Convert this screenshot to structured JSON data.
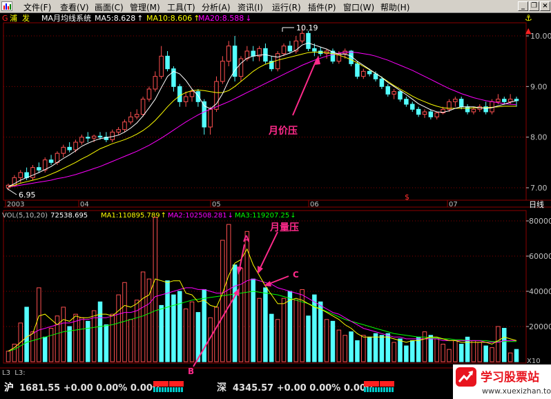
{
  "menu": {
    "items": [
      "文件(F)",
      "查看(V)",
      "画面(C)",
      "管理(M)",
      "工具(T)",
      "分析(A)",
      "资讯(I)",
      "运行(R)",
      "插件(P)",
      "窗口(W)",
      "帮助(H)"
    ]
  },
  "price_panel": {
    "stock_marker": "G",
    "stock_name": "浦  发",
    "indicator_label": "MA月均线系统",
    "ma_labels": [
      {
        "text": "MA5:8.628",
        "arrow": "↑",
        "color": "#ffffff"
      },
      {
        "text": "MA10:8.606",
        "arrow": "↑",
        "color": "#ffff00"
      },
      {
        "text": "MA20:8.588",
        "arrow": "↓",
        "color": "#ff00ff"
      }
    ],
    "y_ticks": [
      "10.00",
      "9.00",
      "8.00",
      "7.00"
    ],
    "high_label": "10.19",
    "low_label": "6.95",
    "annotation": "月价压"
  },
  "x_axis": {
    "labels": [
      "2003",
      "04",
      "05",
      "06",
      "07"
    ],
    "marker": "$",
    "right_label": "日线"
  },
  "volume_panel": {
    "title": "VOL(5,10,20)",
    "vol_value": "72538.695",
    "ma_labels": [
      {
        "text": "MA1:110895.789",
        "arrow": "↑",
        "color": "#ffff00"
      },
      {
        "text": "MA2:102508.281",
        "arrow": "↓",
        "color": "#ff00ff"
      },
      {
        "text": "MA3:119207.25",
        "arrow": "↓",
        "color": "#00ff00"
      }
    ],
    "y_ticks": [
      "80000",
      "60000",
      "40000",
      "20000"
    ],
    "unit_label": "X10",
    "annotation": "月量压",
    "point_labels": [
      "A",
      "B",
      "C"
    ]
  },
  "bottom_row": {
    "left_label": "L3  L3:"
  },
  "status_bar": {
    "sh_label": "沪",
    "sh_text": "1681.55 +0.00 0.00% 0.00亿",
    "sz_label": "深",
    "sz_text": "4345.57 +0.00 0.00% 0.00亿"
  },
  "watermark": {
    "title": "学习股票站",
    "url": "www.xuexizhan.top"
  },
  "colors": {
    "up": "#ff5050",
    "down": "#54ffff",
    "ma5": "#ffffff",
    "ma10": "#ffff00",
    "ma20": "#ff00ff",
    "ma30": "#00ff00",
    "annotation": "#ff2a8a",
    "grid": "#8b0000"
  },
  "chart_data": [
    {
      "type": "candlestick",
      "title": "浦发 月线",
      "ylim": [
        6.9,
        10.3
      ],
      "candles": [
        [
          7.0,
          7.08,
          6.95,
          7.05
        ],
        [
          7.05,
          7.25,
          7.02,
          7.2
        ],
        [
          7.2,
          7.35,
          7.1,
          7.3
        ],
        [
          7.3,
          7.4,
          7.15,
          7.2
        ],
        [
          7.2,
          7.45,
          7.15,
          7.4
        ],
        [
          7.4,
          7.5,
          7.3,
          7.35
        ],
        [
          7.35,
          7.6,
          7.3,
          7.55
        ],
        [
          7.55,
          7.65,
          7.45,
          7.5
        ],
        [
          7.5,
          7.72,
          7.45,
          7.68
        ],
        [
          7.68,
          7.85,
          7.6,
          7.8
        ],
        [
          7.8,
          7.9,
          7.7,
          7.75
        ],
        [
          7.75,
          7.95,
          7.7,
          7.9
        ],
        [
          7.9,
          8.05,
          7.85,
          8.0
        ],
        [
          8.0,
          8.1,
          7.9,
          7.98
        ],
        [
          7.98,
          8.05,
          7.9,
          8.02
        ],
        [
          8.02,
          8.1,
          7.95,
          8.0
        ],
        [
          8.0,
          8.1,
          7.9,
          7.95
        ],
        [
          7.95,
          8.15,
          7.9,
          8.1
        ],
        [
          8.1,
          8.2,
          8.05,
          8.15
        ],
        [
          8.15,
          8.35,
          8.1,
          8.3
        ],
        [
          8.3,
          8.5,
          8.25,
          8.4
        ],
        [
          8.4,
          8.55,
          8.35,
          8.45
        ],
        [
          8.45,
          8.8,
          8.4,
          8.75
        ],
        [
          8.75,
          9.0,
          8.7,
          8.95
        ],
        [
          8.95,
          9.3,
          8.9,
          9.2
        ],
        [
          9.2,
          9.8,
          9.15,
          9.6
        ],
        [
          9.6,
          9.7,
          9.3,
          9.35
        ],
        [
          9.35,
          9.4,
          8.9,
          9.0
        ],
        [
          9.0,
          9.05,
          8.6,
          8.7
        ],
        [
          8.7,
          8.9,
          8.6,
          8.8
        ],
        [
          8.8,
          8.95,
          8.7,
          8.9
        ],
        [
          8.9,
          8.95,
          8.6,
          8.7
        ],
        [
          8.7,
          8.75,
          8.05,
          8.2
        ],
        [
          8.2,
          8.6,
          8.05,
          8.55
        ],
        [
          8.55,
          9.2,
          8.5,
          9.1
        ],
        [
          9.1,
          9.6,
          9.05,
          9.5
        ],
        [
          9.5,
          9.9,
          9.4,
          9.8
        ],
        [
          9.8,
          10.0,
          9.1,
          9.2
        ],
        [
          9.2,
          9.6,
          9.1,
          9.55
        ],
        [
          9.55,
          9.8,
          9.5,
          9.7
        ],
        [
          9.7,
          9.8,
          9.5,
          9.6
        ],
        [
          9.6,
          9.8,
          9.5,
          9.75
        ],
        [
          9.75,
          9.85,
          9.45,
          9.5
        ],
        [
          9.5,
          9.6,
          9.3,
          9.35
        ],
        [
          9.35,
          9.7,
          9.3,
          9.65
        ],
        [
          9.65,
          9.85,
          9.6,
          9.8
        ],
        [
          9.8,
          9.9,
          9.65,
          9.7
        ],
        [
          9.7,
          10.0,
          9.65,
          9.9
        ],
        [
          9.9,
          10.19,
          9.85,
          10.05
        ],
        [
          10.05,
          10.1,
          9.7,
          9.75
        ],
        [
          9.75,
          9.85,
          9.6,
          9.7
        ],
        [
          9.7,
          9.78,
          9.6,
          9.65
        ],
        [
          9.65,
          9.75,
          9.55,
          9.7
        ],
        [
          9.7,
          9.75,
          9.45,
          9.5
        ],
        [
          9.5,
          9.7,
          9.45,
          9.65
        ],
        [
          9.65,
          9.75,
          9.55,
          9.7
        ],
        [
          9.7,
          9.72,
          9.4,
          9.45
        ],
        [
          9.45,
          9.5,
          9.15,
          9.2
        ],
        [
          9.2,
          9.35,
          9.15,
          9.3
        ],
        [
          9.3,
          9.35,
          9.2,
          9.25
        ],
        [
          9.25,
          9.3,
          9.1,
          9.15
        ],
        [
          9.15,
          9.2,
          8.95,
          9.0
        ],
        [
          9.0,
          9.05,
          8.8,
          8.85
        ],
        [
          8.85,
          8.95,
          8.75,
          8.9
        ],
        [
          8.9,
          8.92,
          8.7,
          8.75
        ],
        [
          8.75,
          8.8,
          8.6,
          8.65
        ],
        [
          8.65,
          8.7,
          8.5,
          8.55
        ],
        [
          8.55,
          8.6,
          8.4,
          8.45
        ],
        [
          8.45,
          8.55,
          8.38,
          8.5
        ],
        [
          8.5,
          8.55,
          8.35,
          8.4
        ],
        [
          8.4,
          8.5,
          8.35,
          8.48
        ],
        [
          8.48,
          8.6,
          8.45,
          8.55
        ],
        [
          8.55,
          8.75,
          8.5,
          8.7
        ],
        [
          8.7,
          8.8,
          8.6,
          8.75
        ],
        [
          8.75,
          8.8,
          8.55,
          8.6
        ],
        [
          8.6,
          8.65,
          8.45,
          8.5
        ],
        [
          8.5,
          8.6,
          8.45,
          8.55
        ],
        [
          8.55,
          8.65,
          8.5,
          8.6
        ],
        [
          8.6,
          8.7,
          8.45,
          8.5
        ],
        [
          8.5,
          8.75,
          8.45,
          8.7
        ],
        [
          8.7,
          8.85,
          8.65,
          8.75
        ],
        [
          8.75,
          8.8,
          8.65,
          8.7
        ],
        [
          8.7,
          8.85,
          8.65,
          8.75
        ],
        [
          8.75,
          8.8,
          8.6,
          8.72
        ]
      ],
      "ma5": [
        7.02,
        7.08,
        7.15,
        7.2,
        7.25,
        7.3,
        7.36,
        7.42,
        7.5,
        7.58,
        7.65,
        7.73,
        7.82,
        7.88,
        7.93,
        7.97,
        7.99,
        8.01,
        8.04,
        8.1,
        8.18,
        8.28,
        8.42,
        8.58,
        8.75,
        8.98,
        9.2,
        9.3,
        9.25,
        9.12,
        8.95,
        8.82,
        8.62,
        8.56,
        8.66,
        8.86,
        9.12,
        9.32,
        9.46,
        9.56,
        9.6,
        9.62,
        9.63,
        9.6,
        9.58,
        9.62,
        9.66,
        9.72,
        9.82,
        9.86,
        9.82,
        9.78,
        9.74,
        9.68,
        9.64,
        9.64,
        9.6,
        9.5,
        9.42,
        9.34,
        9.26,
        9.18,
        9.08,
        9.0,
        8.92,
        8.84,
        8.75,
        8.66,
        8.6,
        8.54,
        8.5,
        8.49,
        8.52,
        8.57,
        8.6,
        8.6,
        8.6,
        8.58,
        8.57,
        8.58,
        8.62,
        8.65,
        8.69,
        8.72
      ],
      "ma10": [
        7.02,
        7.05,
        7.09,
        7.12,
        7.15,
        7.18,
        7.22,
        7.27,
        7.32,
        7.38,
        7.44,
        7.5,
        7.57,
        7.63,
        7.7,
        7.77,
        7.82,
        7.87,
        7.91,
        7.95,
        8.0,
        8.06,
        8.13,
        8.22,
        8.33,
        8.46,
        8.6,
        8.72,
        8.82,
        8.88,
        8.92,
        8.93,
        8.92,
        8.9,
        8.88,
        8.88,
        8.92,
        9.0,
        9.1,
        9.2,
        9.3,
        9.38,
        9.44,
        9.48,
        9.52,
        9.55,
        9.58,
        9.61,
        9.64,
        9.67,
        9.68,
        9.68,
        9.67,
        9.65,
        9.62,
        9.58,
        9.53,
        9.47,
        9.4,
        9.33,
        9.26,
        9.18,
        9.1,
        9.02,
        8.95,
        8.88,
        8.81,
        8.75,
        8.7,
        8.65,
        8.61,
        8.58,
        8.57,
        8.57,
        8.57,
        8.57,
        8.58,
        8.58,
        8.58,
        8.59,
        8.6,
        8.61,
        8.61,
        8.61
      ],
      "ma20": [
        7.02,
        7.03,
        7.05,
        7.07,
        7.09,
        7.11,
        7.13,
        7.15,
        7.18,
        7.2,
        7.23,
        7.26,
        7.3,
        7.34,
        7.38,
        7.42,
        7.47,
        7.52,
        7.57,
        7.62,
        7.67,
        7.72,
        7.78,
        7.84,
        7.91,
        7.98,
        8.06,
        8.14,
        8.22,
        8.3,
        8.37,
        8.44,
        8.5,
        8.55,
        8.6,
        8.65,
        8.7,
        8.76,
        8.82,
        8.88,
        8.94,
        9.0,
        9.06,
        9.12,
        9.18,
        9.24,
        9.3,
        9.36,
        9.42,
        9.47,
        9.52,
        9.56,
        9.6,
        9.63,
        9.66,
        9.68,
        9.68,
        9.67,
        9.65,
        9.63,
        9.6,
        9.56,
        9.52,
        9.47,
        9.42,
        9.37,
        9.32,
        9.26,
        9.2,
        9.14,
        9.08,
        9.02,
        8.96,
        8.91,
        8.86,
        8.82,
        8.78,
        8.75,
        8.72,
        8.7,
        8.68,
        8.66,
        8.65,
        8.64
      ]
    },
    {
      "type": "bar",
      "title": "VOL(5,10,20)",
      "ylim": [
        0,
        85000
      ],
      "values": [
        6000,
        10000,
        22000,
        31000,
        17000,
        42000,
        14000,
        19000,
        26000,
        31000,
        20000,
        27000,
        25000,
        23000,
        29000,
        34000,
        21000,
        27000,
        38000,
        45000,
        24000,
        35000,
        51000,
        47000,
        82000,
        32000,
        46000,
        38000,
        40000,
        30000,
        34000,
        28000,
        41000,
        25000,
        31000,
        69000,
        78000,
        55000,
        53000,
        74000,
        47000,
        36000,
        42000,
        27000,
        24000,
        36000,
        40000,
        35000,
        41000,
        26000,
        38000,
        34000,
        24000,
        23000,
        18000,
        15000,
        17000,
        12000,
        15000,
        14000,
        16000,
        15000,
        16000,
        11000,
        13000,
        9000,
        12000,
        14000,
        17000,
        15000,
        13000,
        10000,
        7000,
        12000,
        10000,
        14000,
        12000,
        11000,
        9000,
        8000,
        20000,
        19000,
        5000,
        7000
      ],
      "up": [
        true,
        true,
        true,
        false,
        true,
        true,
        false,
        true,
        true,
        true,
        false,
        true,
        true,
        false,
        true,
        false,
        false,
        true,
        true,
        true,
        true,
        true,
        true,
        true,
        true,
        false,
        false,
        false,
        false,
        true,
        true,
        false,
        false,
        true,
        true,
        true,
        true,
        false,
        true,
        true,
        false,
        true,
        false,
        false,
        true,
        true,
        false,
        true,
        true,
        false,
        false,
        false,
        true,
        false,
        true,
        true,
        false,
        false,
        true,
        false,
        false,
        false,
        false,
        true,
        false,
        false,
        false,
        false,
        true,
        false,
        true,
        true,
        true,
        true,
        false,
        false,
        true,
        true,
        false,
        true,
        true,
        false,
        true,
        false
      ],
      "ma5": [
        6000,
        8000,
        11000,
        14000,
        16000,
        26000,
        27000,
        24000,
        21000,
        24000,
        23000,
        26000,
        25000,
        25000,
        26000,
        27000,
        27000,
        26000,
        29000,
        32000,
        31000,
        33000,
        36000,
        38000,
        47000,
        46000,
        45000,
        46000,
        46000,
        39000,
        38000,
        34000,
        35000,
        32000,
        31000,
        39000,
        49000,
        56000,
        58000,
        64000,
        55000,
        49000,
        43000,
        38000,
        33000,
        33000,
        35000,
        36000,
        35000,
        33000,
        31000,
        30000,
        28000,
        26000,
        24000,
        21000,
        19000,
        16000,
        14000,
        14000,
        14000,
        14000,
        14000,
        13000,
        12000,
        11000,
        12000,
        12000,
        13000,
        14000,
        14000,
        13000,
        12000,
        12000,
        11000,
        11000,
        11000,
        11000,
        11000,
        10000,
        12000,
        14000,
        13000,
        12000
      ],
      "ma10": [
        6000,
        8000,
        11000,
        14000,
        16000,
        18000,
        19000,
        20000,
        21000,
        22000,
        22000,
        23000,
        24000,
        24000,
        25000,
        25000,
        25000,
        26000,
        27000,
        28000,
        28000,
        29000,
        31000,
        33000,
        37000,
        38000,
        39000,
        40000,
        41000,
        42000,
        42000,
        41000,
        41000,
        40000,
        39000,
        39000,
        41000,
        43000,
        44000,
        46000,
        47000,
        46000,
        45000,
        44000,
        42000,
        41000,
        40000,
        39000,
        38000,
        36000,
        34000,
        32000,
        30000,
        28000,
        27000,
        25000,
        23000,
        21000,
        19000,
        18000,
        17000,
        16000,
        15000,
        14000,
        14000,
        13000,
        13000,
        13000,
        13000,
        13000,
        13000,
        12000,
        12000,
        12000,
        12000,
        12000,
        12000,
        12000,
        11000,
        11000,
        11000,
        12000,
        12000,
        12000
      ],
      "ma20": [
        6000,
        7000,
        9000,
        11000,
        12000,
        13000,
        14000,
        15000,
        16000,
        17000,
        17500,
        18000,
        18500,
        19000,
        19500,
        20000,
        20500,
        21000,
        22000,
        23000,
        24000,
        25000,
        26000,
        27500,
        29000,
        30000,
        31000,
        32000,
        33000,
        34000,
        35000,
        35500,
        36000,
        36500,
        37000,
        37500,
        38000,
        38500,
        39000,
        39500,
        40000,
        39500,
        39000,
        38500,
        38000,
        37000,
        36000,
        35000,
        34000,
        33000,
        31500,
        30000,
        28500,
        27000,
        25500,
        24000,
        23000,
        22000,
        21000,
        20000,
        19000,
        18000,
        17000,
        16000,
        15500,
        15000,
        14500,
        14000,
        14000,
        13500,
        13500,
        13000,
        13000,
        12500,
        12500,
        12000,
        12000,
        12000,
        12000,
        11500,
        11500,
        11500,
        11500,
        11500
      ]
    }
  ]
}
